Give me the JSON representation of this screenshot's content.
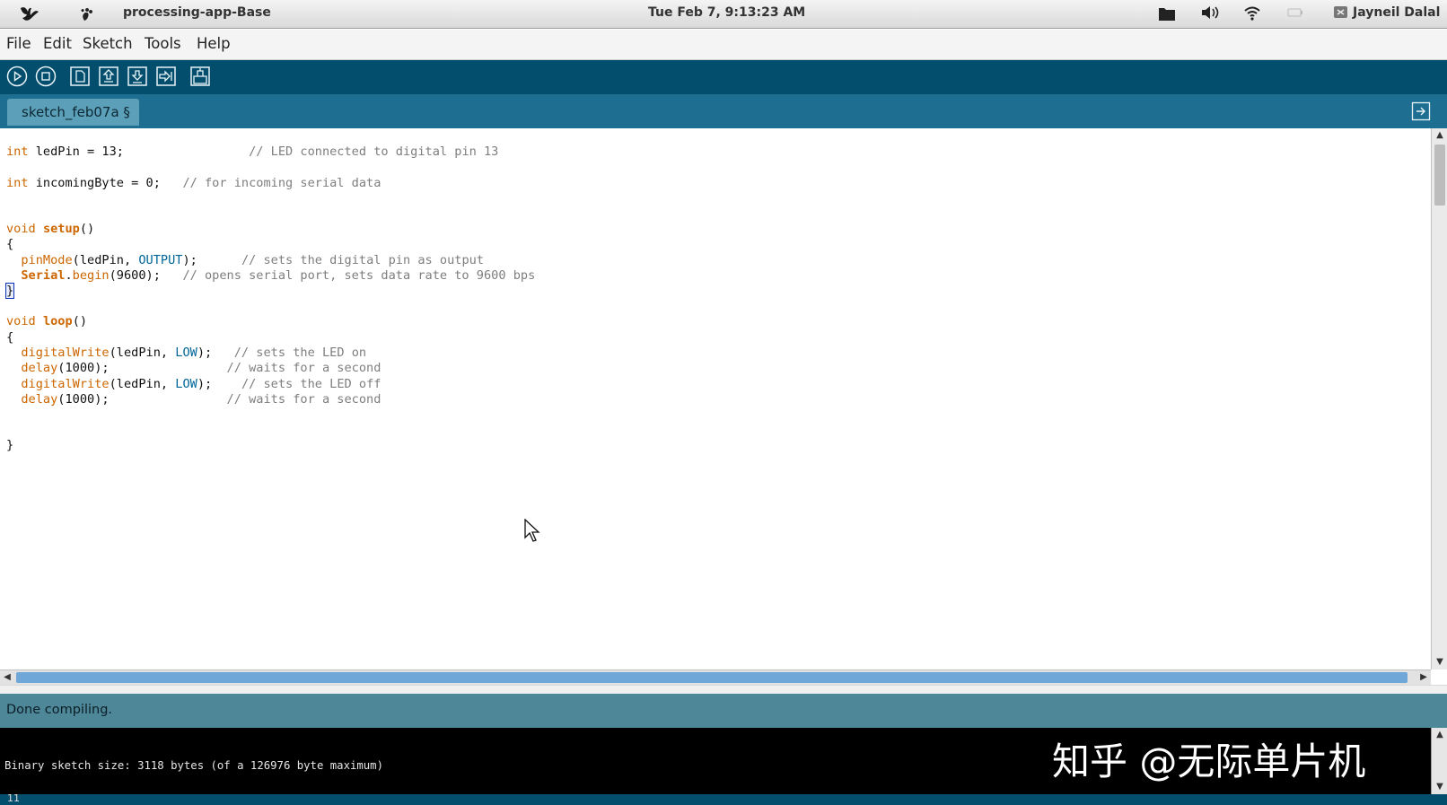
{
  "system_bar": {
    "app_name": "processing-app-Base",
    "clock": "Tue Feb 7,  9:13:23 AM",
    "user": "Jayneil Dalal"
  },
  "menu": [
    "File",
    "Edit",
    "Sketch",
    "Tools",
    "Help"
  ],
  "toolbar": {
    "buttons": [
      "verify",
      "stop",
      "new",
      "open",
      "save",
      "upload",
      "serial-monitor"
    ]
  },
  "tab": {
    "label": "sketch_feb07a §"
  },
  "code": {
    "line1": [
      "int",
      " ledPin = 13;",
      "                 // LED connected to digital pin 13"
    ],
    "line2": [
      "int",
      " incomingByte = 0;",
      "   // for incoming serial data"
    ],
    "line3": [
      "void",
      " ",
      "setup",
      "()"
    ],
    "line4": "{",
    "line5": [
      "  ",
      "pinMode",
      "(ledPin, ",
      "OUTPUT",
      ");      ",
      "// sets the digital pin as output"
    ],
    "line6": [
      "  ",
      "Serial",
      ".",
      "begin",
      "(9600);   ",
      "// opens serial port, sets data rate to 9600 bps"
    ],
    "line7": "}",
    "line8": [
      "void",
      " ",
      "loop",
      "()"
    ],
    "line9": "{",
    "line10": [
      "  ",
      "digitalWrite",
      "(ledPin, ",
      "LOW",
      ");   ",
      "// sets the LED on"
    ],
    "line11": [
      "  ",
      "delay",
      "(1000);                ",
      "// waits for a second"
    ],
    "line12": [
      "  ",
      "digitalWrite",
      "(ledPin, ",
      "LOW",
      ");    ",
      "// sets the LED off"
    ],
    "line13": [
      "  ",
      "delay",
      "(1000);                ",
      "// waits for a second"
    ],
    "line14": "}"
  },
  "status": {
    "message": "Done compiling."
  },
  "console": {
    "output": "Binary sketch size: 3118 bytes (of a 126976 byte maximum)",
    "watermark": "知乎 @无际单片机"
  },
  "bottom_line_number": "11",
  "colors": {
    "toolbar_bg": "#044e6d",
    "tabstrip_bg": "#1e6e92",
    "status_bg": "#4e8798",
    "keyword": "#cc6600",
    "constant": "#006699",
    "comment": "#7e7e7e"
  }
}
